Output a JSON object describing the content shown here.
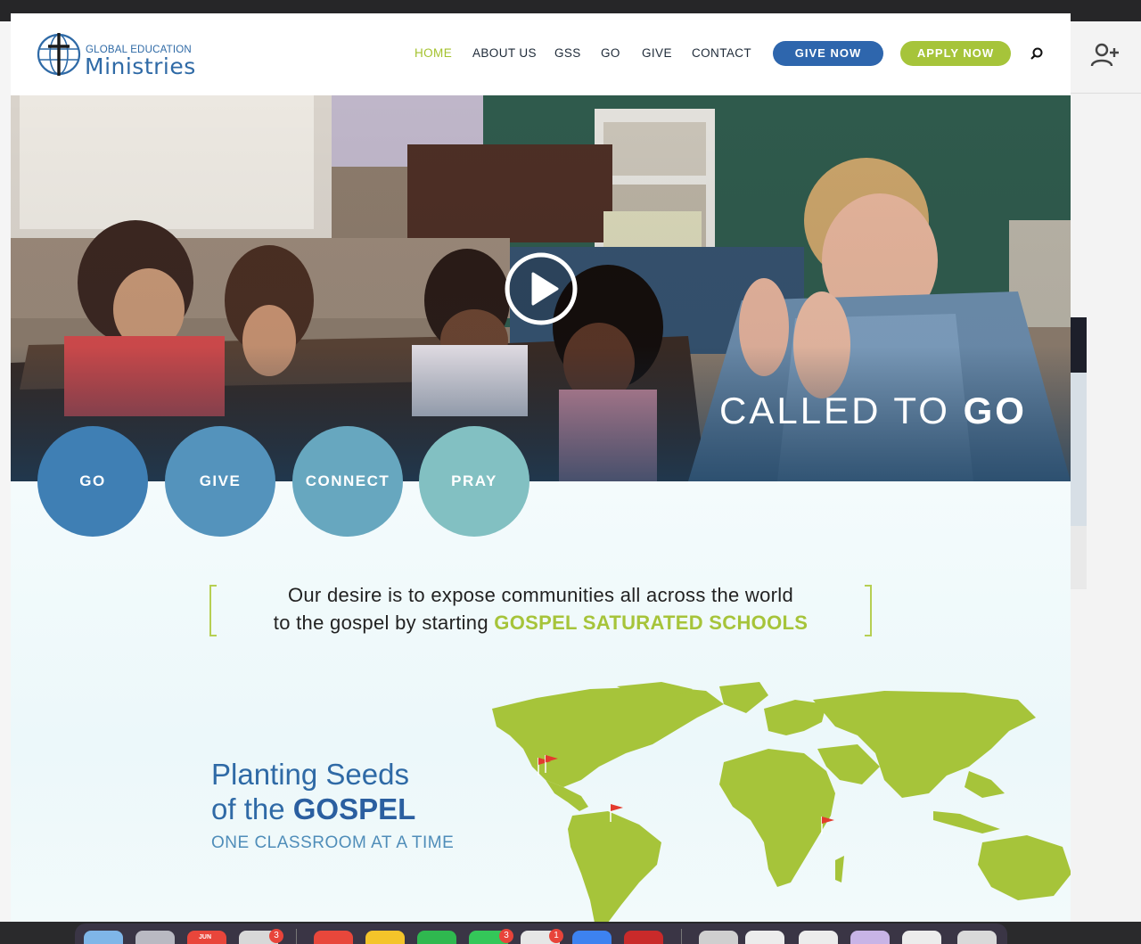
{
  "site": {
    "logo_top": "GLOBAL EDUCATION",
    "logo_main": "Ministries"
  },
  "nav": {
    "home": "HOME",
    "about": "ABOUT US",
    "gss": "GSS",
    "go": "GO",
    "give": "GIVE",
    "contact": "CONTACT",
    "give_now": "GIVE NOW",
    "apply_now": "APPLY NOW"
  },
  "hero": {
    "title_light": "CALLED TO ",
    "title_bold": "GO"
  },
  "circles": {
    "go": "GO",
    "give": "GIVE",
    "connect": "CONNECT",
    "pray": "PRAY"
  },
  "quote": {
    "line1": "Our desire is to expose communities all across the world",
    "line2_prefix": "to the gospel by starting ",
    "line2_highlight": "GOSPEL SATURATED SCHOOLS"
  },
  "planting": {
    "line1": "Planting Seeds",
    "line2_prefix": "of the ",
    "line2_bold": "GOSPEL",
    "tagline": "ONE CLASSROOM AT A TIME"
  },
  "dock": {
    "calendar_month": "JUN",
    "badges": [
      "3",
      "3",
      "1"
    ]
  },
  "colors": {
    "brand_blue": "#2e66ad",
    "brand_green": "#a6c43a",
    "circle_go": "#3f7fb4",
    "circle_give": "#5493bc",
    "circle_connect": "#67a7bf",
    "circle_pray": "#82c0c2"
  },
  "icons": [
    "add-user-icon",
    "search-icon",
    "play-icon",
    "world-map",
    "flag-icon"
  ]
}
